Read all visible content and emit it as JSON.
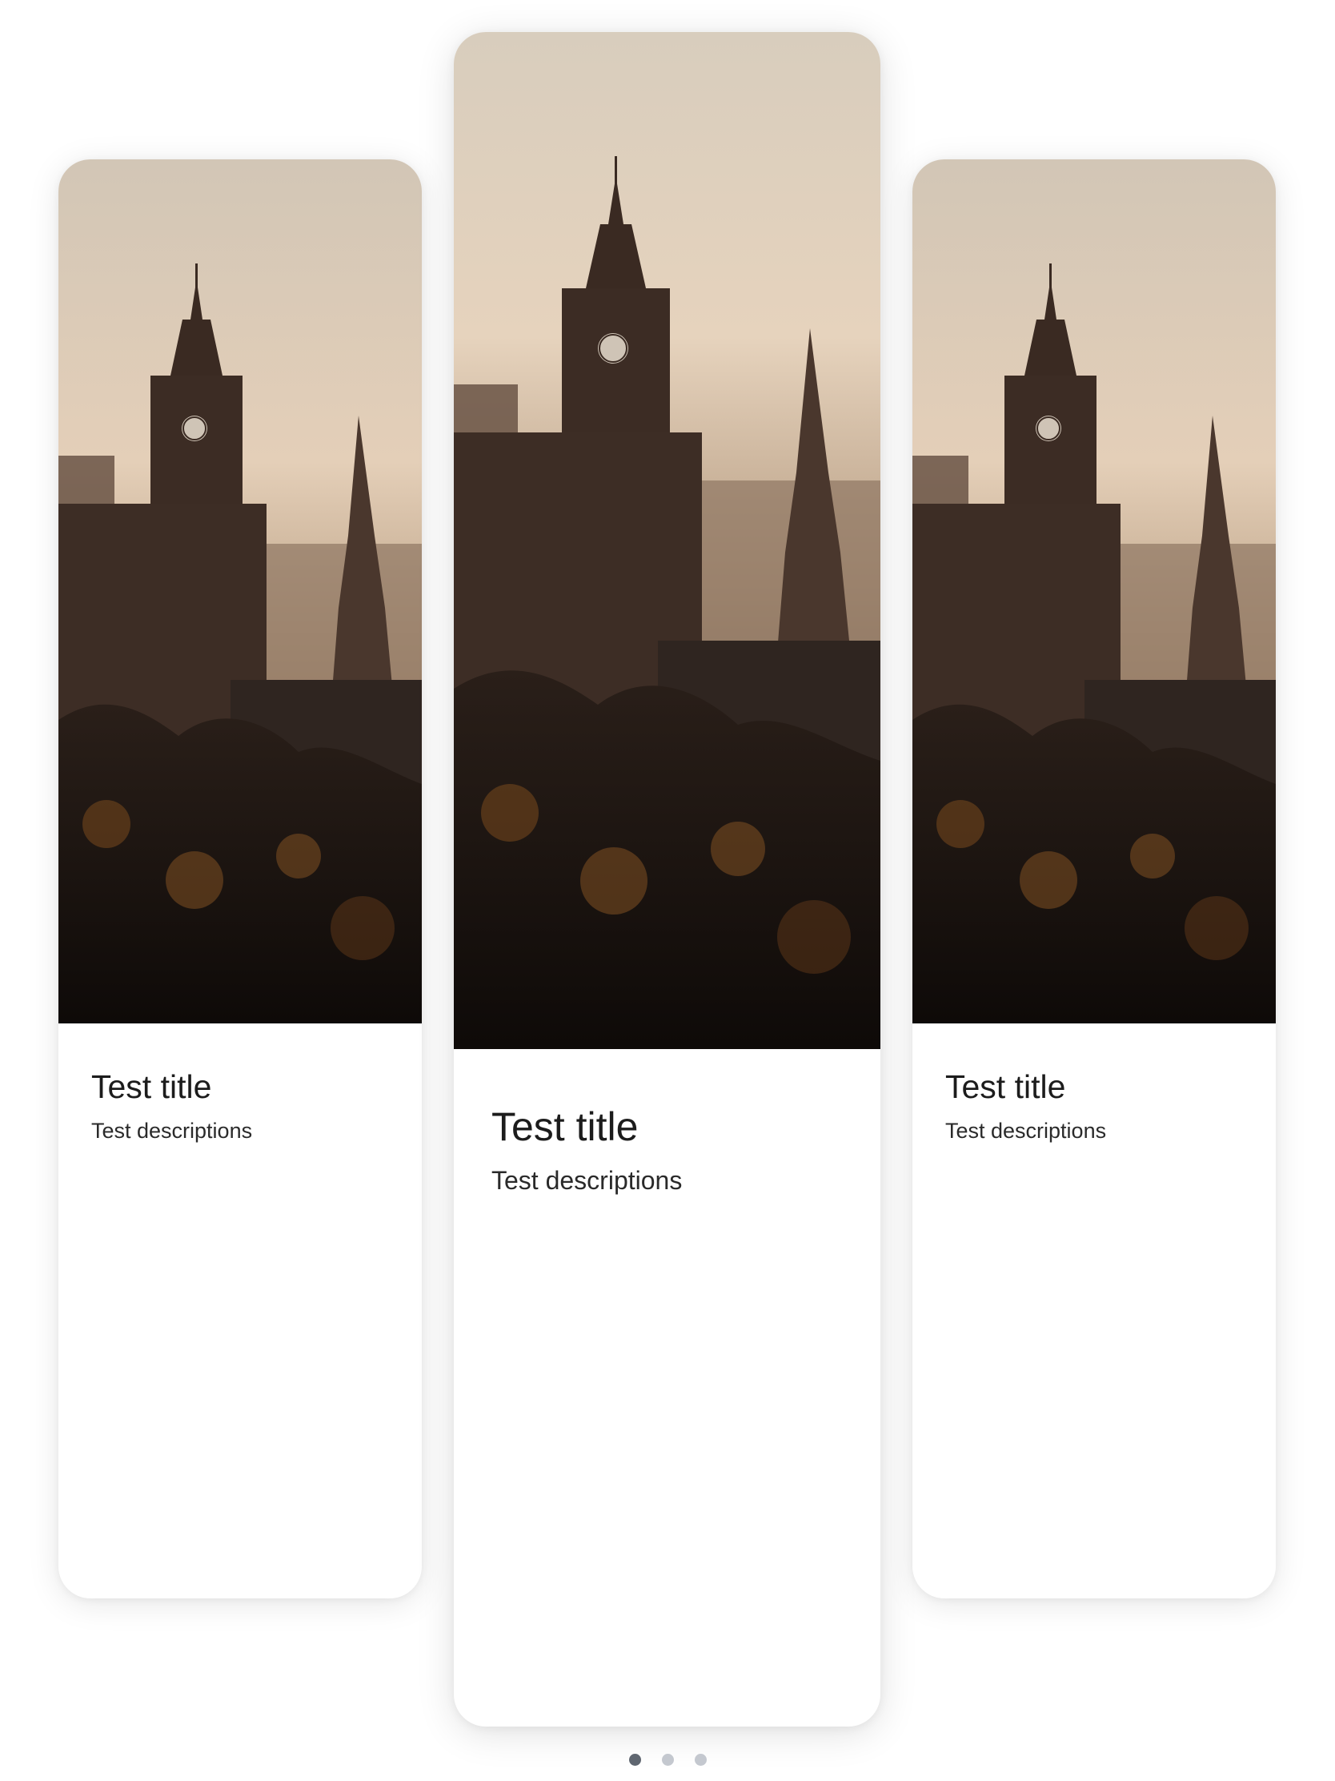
{
  "cards": [
    {
      "title": "Test title",
      "description": "Test descriptions",
      "image": "edinburgh-clock-tower-skyline-photo"
    },
    {
      "title": "Test title",
      "description": "Test descriptions",
      "image": "edinburgh-clock-tower-skyline-photo"
    },
    {
      "title": "Test title",
      "description": "Test descriptions",
      "image": "edinburgh-clock-tower-skyline-photo"
    }
  ],
  "pagination": {
    "count": 3,
    "active_index": 0
  },
  "colors": {
    "sky_top": "#d8cdbd",
    "sky_mid": "#e6d3bd",
    "haze": "#b69c82",
    "silhouette": "#3a2a22",
    "foreground": "#140e0b",
    "dot_active": "#5f6670",
    "dot_inactive": "#c4c8cf"
  }
}
